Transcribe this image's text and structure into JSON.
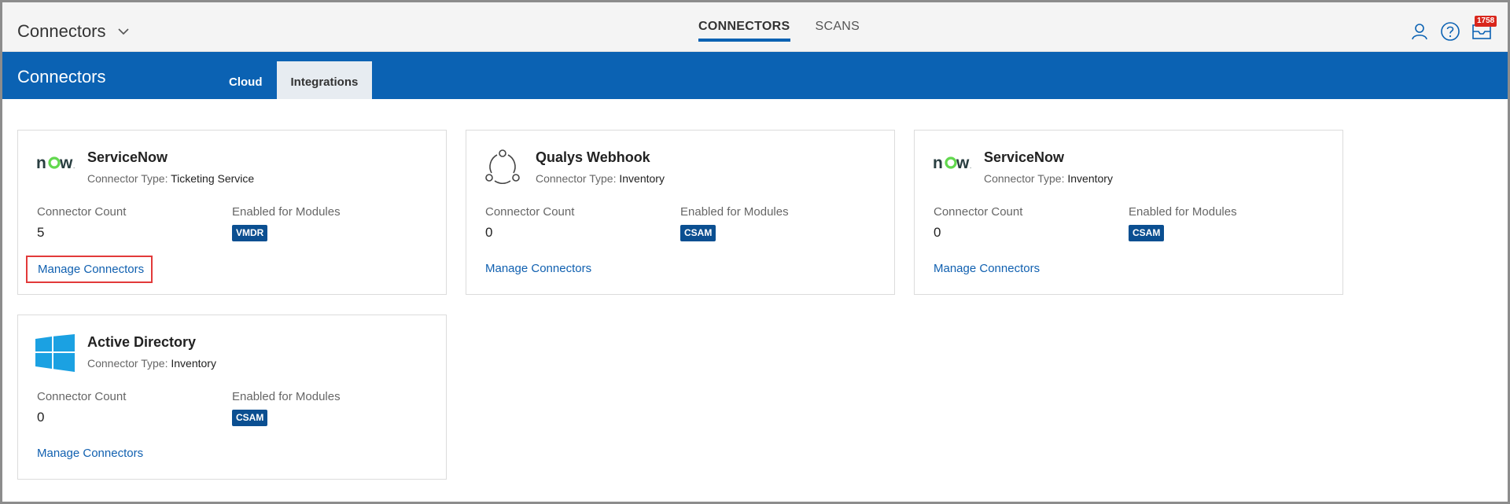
{
  "header": {
    "app_title": "Connectors",
    "tabs": [
      {
        "label": "CONNECTORS",
        "active": true
      },
      {
        "label": "SCANS",
        "active": false
      }
    ],
    "notification_count": "1758"
  },
  "band": {
    "title": "Connectors",
    "tabs": [
      {
        "label": "Cloud",
        "active": false
      },
      {
        "label": "Integrations",
        "active": true
      }
    ]
  },
  "labels": {
    "connector_type": "Connector Type:",
    "connector_count": "Connector Count",
    "enabled_for_modules": "Enabled for Modules",
    "manage_connectors": "Manage Connectors"
  },
  "cards": [
    {
      "name": "ServiceNow",
      "type": "Ticketing Service",
      "count": "5",
      "module": "VMDR",
      "logo": "servicenow-logo"
    },
    {
      "name": "Qualys Webhook",
      "type": "Inventory",
      "count": "0",
      "module": "CSAM",
      "logo": "webhook-icon"
    },
    {
      "name": "ServiceNow",
      "type": "Inventory",
      "count": "0",
      "module": "CSAM",
      "logo": "servicenow-logo"
    },
    {
      "name": "Active Directory",
      "type": "Inventory",
      "count": "0",
      "module": "CSAM",
      "logo": "windows-logo"
    }
  ],
  "colors": {
    "brand_blue": "#0b62b3",
    "badge_blue": "#0b4f91",
    "link_blue": "#1060b0",
    "highlight_red": "#e23a3a",
    "notification_red": "#d9261c",
    "windows_blue": "#1ba1e2",
    "servicenow_green": "#62d84e"
  }
}
